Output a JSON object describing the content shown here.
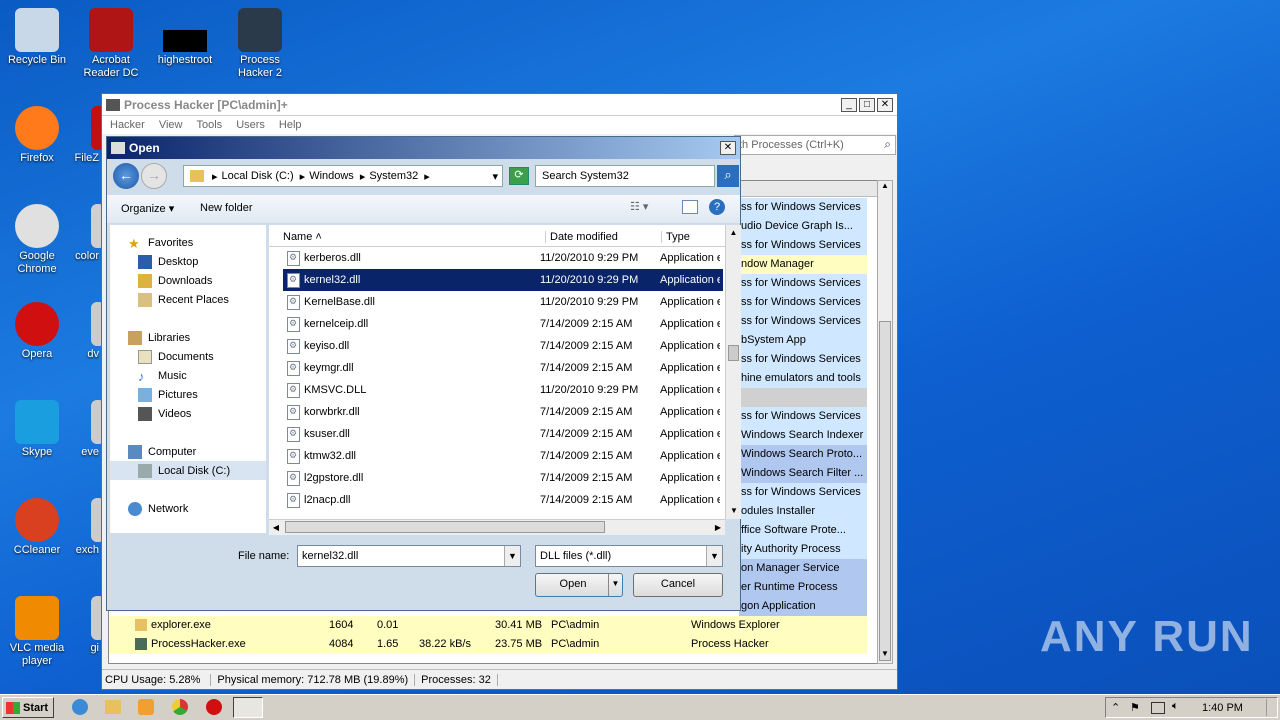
{
  "desktop": {
    "icons": [
      {
        "label": "Recycle Bin"
      },
      {
        "label": "Acrobat Reader DC"
      },
      {
        "label": "highestroot"
      },
      {
        "label": "Process Hacker 2"
      },
      {
        "label": "Firefox"
      },
      {
        "label": "FileZ"
      },
      {
        "label": "Google Chrome"
      },
      {
        "label": "color"
      },
      {
        "label": "Opera"
      },
      {
        "label": "dv"
      },
      {
        "label": "Skype"
      },
      {
        "label": "eve"
      },
      {
        "label": "CCleaner"
      },
      {
        "label": "exch"
      },
      {
        "label": "VLC media player"
      },
      {
        "label": "gi"
      }
    ],
    "watermark": "ANY RUN"
  },
  "process_hacker": {
    "title": "Process Hacker [PC\\admin]+",
    "menu": [
      "Hacker",
      "View",
      "Tools",
      "Users",
      "Help"
    ],
    "search_placeholder": "th Processes (Ctrl+K)",
    "right_rows": [
      {
        "text": "ss for Windows Services",
        "color": "#d0e8ff"
      },
      {
        "text": "udio Device Graph Is...",
        "color": "#d0e8ff"
      },
      {
        "text": "ss for Windows Services",
        "color": "#d0e8ff"
      },
      {
        "text": "ndow Manager",
        "color": "#fffdc0"
      },
      {
        "text": "ss for Windows Services",
        "color": "#d0e8ff"
      },
      {
        "text": "ss for Windows Services",
        "color": "#d0e8ff"
      },
      {
        "text": "ss for Windows Services",
        "color": "#d0e8ff"
      },
      {
        "text": "bSystem App",
        "color": "#d0e8ff"
      },
      {
        "text": "ss for Windows Services",
        "color": "#d0e8ff"
      },
      {
        "text": "hine emulators and tools",
        "color": "#d0e8ff"
      },
      {
        "text": "",
        "color": "#d0d0d0"
      },
      {
        "text": "ss for Windows Services",
        "color": "#d0e8ff"
      },
      {
        "text": "Windows Search Indexer",
        "color": "#d0e8ff"
      },
      {
        "text": "Windows Search Proto...",
        "color": "#b0c8f0"
      },
      {
        "text": "Windows Search Filter ...",
        "color": "#b0c8f0"
      },
      {
        "text": "ss for Windows Services",
        "color": "#d0e8ff"
      },
      {
        "text": "odules Installer",
        "color": "#d0e8ff"
      },
      {
        "text": "ffice Software Prote...",
        "color": "#d0e8ff"
      },
      {
        "text": "ity Authority Process",
        "color": "#d0e8ff"
      },
      {
        "text": "on Manager Service",
        "color": "#b0c8f0"
      },
      {
        "text": "er Runtime Process",
        "color": "#b0c8f0"
      },
      {
        "text": "gon Application",
        "color": "#b0c8f0"
      }
    ],
    "bottom_rows": [
      {
        "name": "explorer.exe",
        "pid": "1604",
        "cpu": "0.01",
        "io": "",
        "mem": "30.41 MB",
        "user": "PC\\admin",
        "desc": "Windows Explorer"
      },
      {
        "name": "ProcessHacker.exe",
        "pid": "4084",
        "cpu": "1.65",
        "io": "38.22 kB/s",
        "mem": "23.75 MB",
        "user": "PC\\admin",
        "desc": "Process Hacker"
      }
    ],
    "status": {
      "cpu": "CPU Usage: 5.28%",
      "mem": "Physical memory: 712.78 MB (19.89%)",
      "procs": "Processes: 32"
    }
  },
  "open_dialog": {
    "title": "Open",
    "breadcrumb": [
      "Local Disk (C:)",
      "Windows",
      "System32"
    ],
    "search_placeholder": "Search System32",
    "toolbar": {
      "organize": "Organize",
      "new_folder": "New folder"
    },
    "nav": {
      "favorites": "Favorites",
      "fav_items": [
        "Desktop",
        "Downloads",
        "Recent Places"
      ],
      "libraries": "Libraries",
      "lib_items": [
        "Documents",
        "Music",
        "Pictures",
        "Videos"
      ],
      "computer": "Computer",
      "computer_items": [
        "Local Disk (C:)"
      ],
      "network": "Network"
    },
    "columns": {
      "name": "Name",
      "date": "Date modified",
      "type": "Type"
    },
    "files": [
      {
        "name": "kerberos.dll",
        "date": "11/20/2010 9:29 PM",
        "type": "Application e"
      },
      {
        "name": "kernel32.dll",
        "date": "11/20/2010 9:29 PM",
        "type": "Application e"
      },
      {
        "name": "KernelBase.dll",
        "date": "11/20/2010 9:29 PM",
        "type": "Application e"
      },
      {
        "name": "kernelceip.dll",
        "date": "7/14/2009 2:15 AM",
        "type": "Application e"
      },
      {
        "name": "keyiso.dll",
        "date": "7/14/2009 2:15 AM",
        "type": "Application e"
      },
      {
        "name": "keymgr.dll",
        "date": "7/14/2009 2:15 AM",
        "type": "Application e"
      },
      {
        "name": "KMSVC.DLL",
        "date": "11/20/2010 9:29 PM",
        "type": "Application e"
      },
      {
        "name": "korwbrkr.dll",
        "date": "7/14/2009 2:15 AM",
        "type": "Application e"
      },
      {
        "name": "ksuser.dll",
        "date": "7/14/2009 2:15 AM",
        "type": "Application e"
      },
      {
        "name": "ktmw32.dll",
        "date": "7/14/2009 2:15 AM",
        "type": "Application e"
      },
      {
        "name": "l2gpstore.dll",
        "date": "7/14/2009 2:15 AM",
        "type": "Application e"
      },
      {
        "name": "l2nacp.dll",
        "date": "7/14/2009 2:15 AM",
        "type": "Application e"
      }
    ],
    "filename_label": "File name:",
    "filename_value": "kernel32.dll",
    "filter": "DLL files (*.dll)",
    "open_label": "Open",
    "cancel_label": "Cancel"
  },
  "taskbar": {
    "start": "Start",
    "time": "1:40 PM"
  }
}
